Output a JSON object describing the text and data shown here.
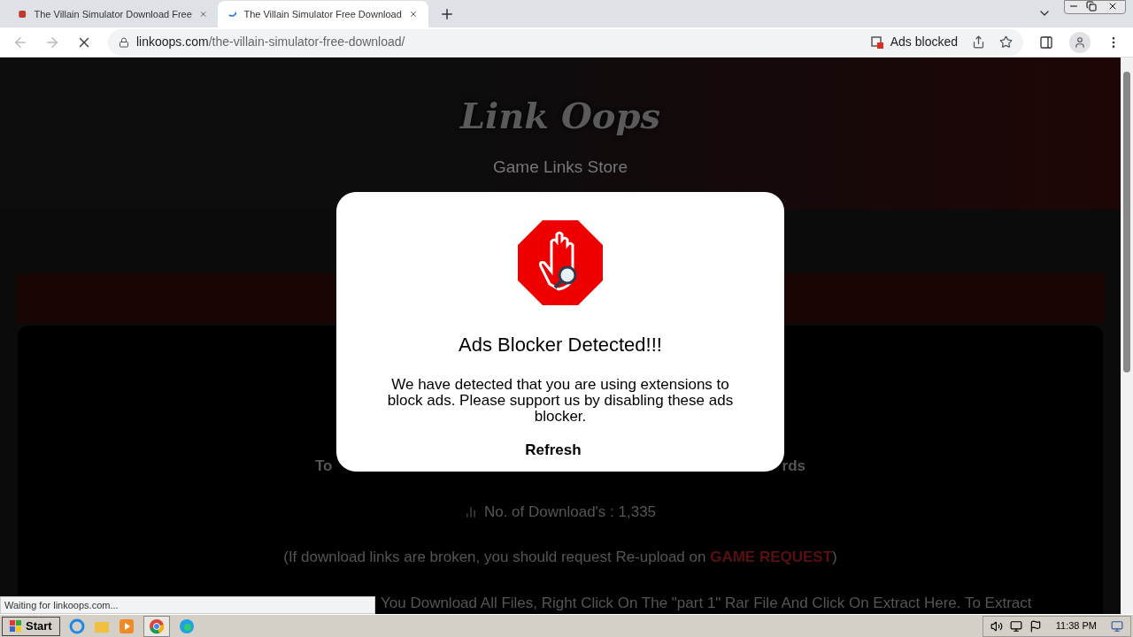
{
  "tabs": [
    {
      "title": "The Villain Simulator Download Free",
      "selected": false,
      "loading": false
    },
    {
      "title": "The Villain Simulator Free Download",
      "selected": true,
      "loading": true
    }
  ],
  "address": {
    "domain": "linkoops.com",
    "path": "/the-villain-simulator-free-download/"
  },
  "ads_blocked": "Ads blocked",
  "page": {
    "logo": "Link Oops",
    "tagline": "Game Links Store",
    "line_left": "To",
    "line_right": "rds",
    "downloads": "No. of Download's : 1,335",
    "broken_pre": "(If download links are broken, you should request Re-upload on ",
    "broken_link": "GAME REQUEST",
    "broken_post": ")",
    "instructions": "You Download All Files, Right Click On The \"part 1\" Rar File And Click On Extract Here. To Extract"
  },
  "modal": {
    "title": "Ads Blocker Detected!!!",
    "message": "We have detected that you are using extensions to block ads. Please support us by disabling these ads blocker.",
    "button": "Refresh"
  },
  "status": "Waiting for linkoops.com...",
  "taskbar": {
    "start": "Start",
    "clock": "11:38 PM"
  }
}
